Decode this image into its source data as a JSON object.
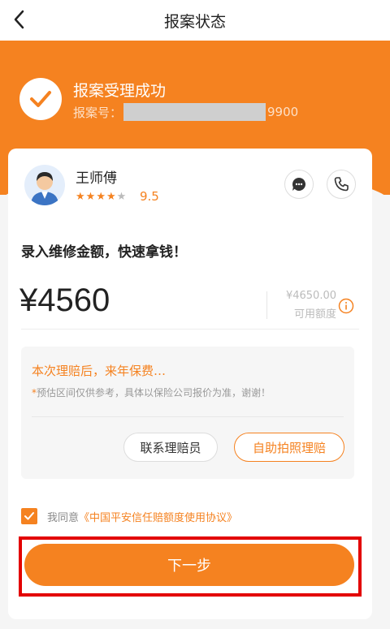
{
  "nav": {
    "title": "报案状态"
  },
  "status": {
    "title": "报案受理成功",
    "case_label": "报案号：",
    "case_suffix": "9900"
  },
  "agent": {
    "name": "王师傅",
    "rating": "9.5",
    "stars_filled": 4,
    "stars_total": 5
  },
  "prompt": "录入维修金额，快速拿钱！",
  "amount": {
    "value": "¥4560",
    "available_value": "¥4650.00",
    "available_label": "可用额度"
  },
  "estimate": {
    "title": "本次理赔后，来年保费…",
    "note_star": "*",
    "note": "预估区间仅供参考，具体以保险公司报价为准，谢谢！"
  },
  "buttons": {
    "contact": "联系理赔员",
    "photo": "自助拍照理赔",
    "next": "下一步"
  },
  "agreement": {
    "prefix": "我同意",
    "link": "《中国平安信任赔额度使用协议》",
    "checked": true
  },
  "colors": {
    "accent": "#f58220",
    "highlight": "#e30000"
  }
}
